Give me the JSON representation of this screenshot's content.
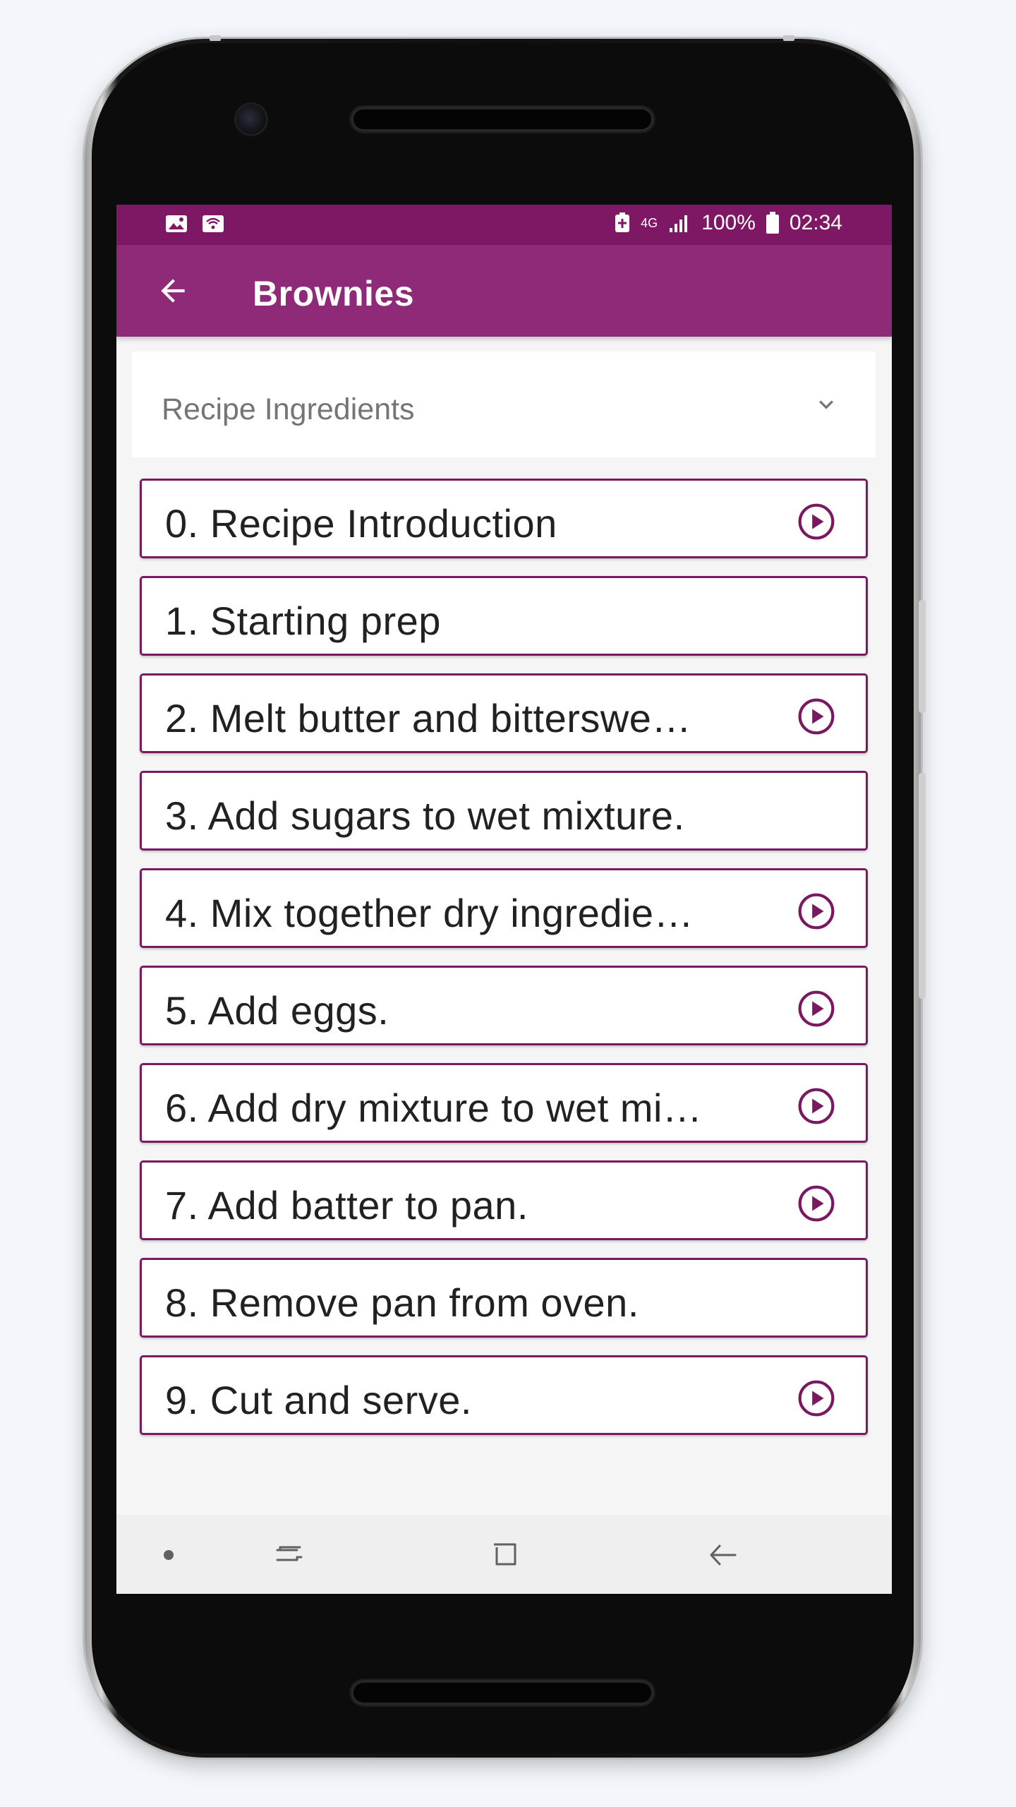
{
  "status_bar": {
    "left_icons": [
      "image-icon",
      "wifi-calling-icon"
    ],
    "network": "4G",
    "battery": "100%",
    "time": "02:34"
  },
  "app_bar": {
    "title": "Brownies",
    "back_icon": "arrow-back-icon"
  },
  "ingredients": {
    "label": "Recipe Ingredients",
    "expand_icon": "chevron-down-icon"
  },
  "steps": [
    {
      "label": "0. Recipe Introduction",
      "has_video": true
    },
    {
      "label": "1. Starting prep",
      "has_video": false
    },
    {
      "label": "2. Melt butter and bitterswe…",
      "has_video": true
    },
    {
      "label": "3. Add sugars to wet mixture.",
      "has_video": false
    },
    {
      "label": "4. Mix together dry ingredie…",
      "has_video": true
    },
    {
      "label": "5. Add eggs.",
      "has_video": true
    },
    {
      "label": "6. Add dry mixture to wet mi…",
      "has_video": true
    },
    {
      "label": "7. Add batter to pan.",
      "has_video": true
    },
    {
      "label": "8. Remove pan from oven.",
      "has_video": false
    },
    {
      "label": "9. Cut and serve.",
      "has_video": true
    }
  ],
  "nav_bar": {
    "icons": [
      "dot-icon",
      "recent-apps-icon",
      "home-icon",
      "back-icon"
    ]
  },
  "colors": {
    "primary": "#8f2a78",
    "primary_dark": "#7e1764",
    "accent": "#7b1862"
  }
}
